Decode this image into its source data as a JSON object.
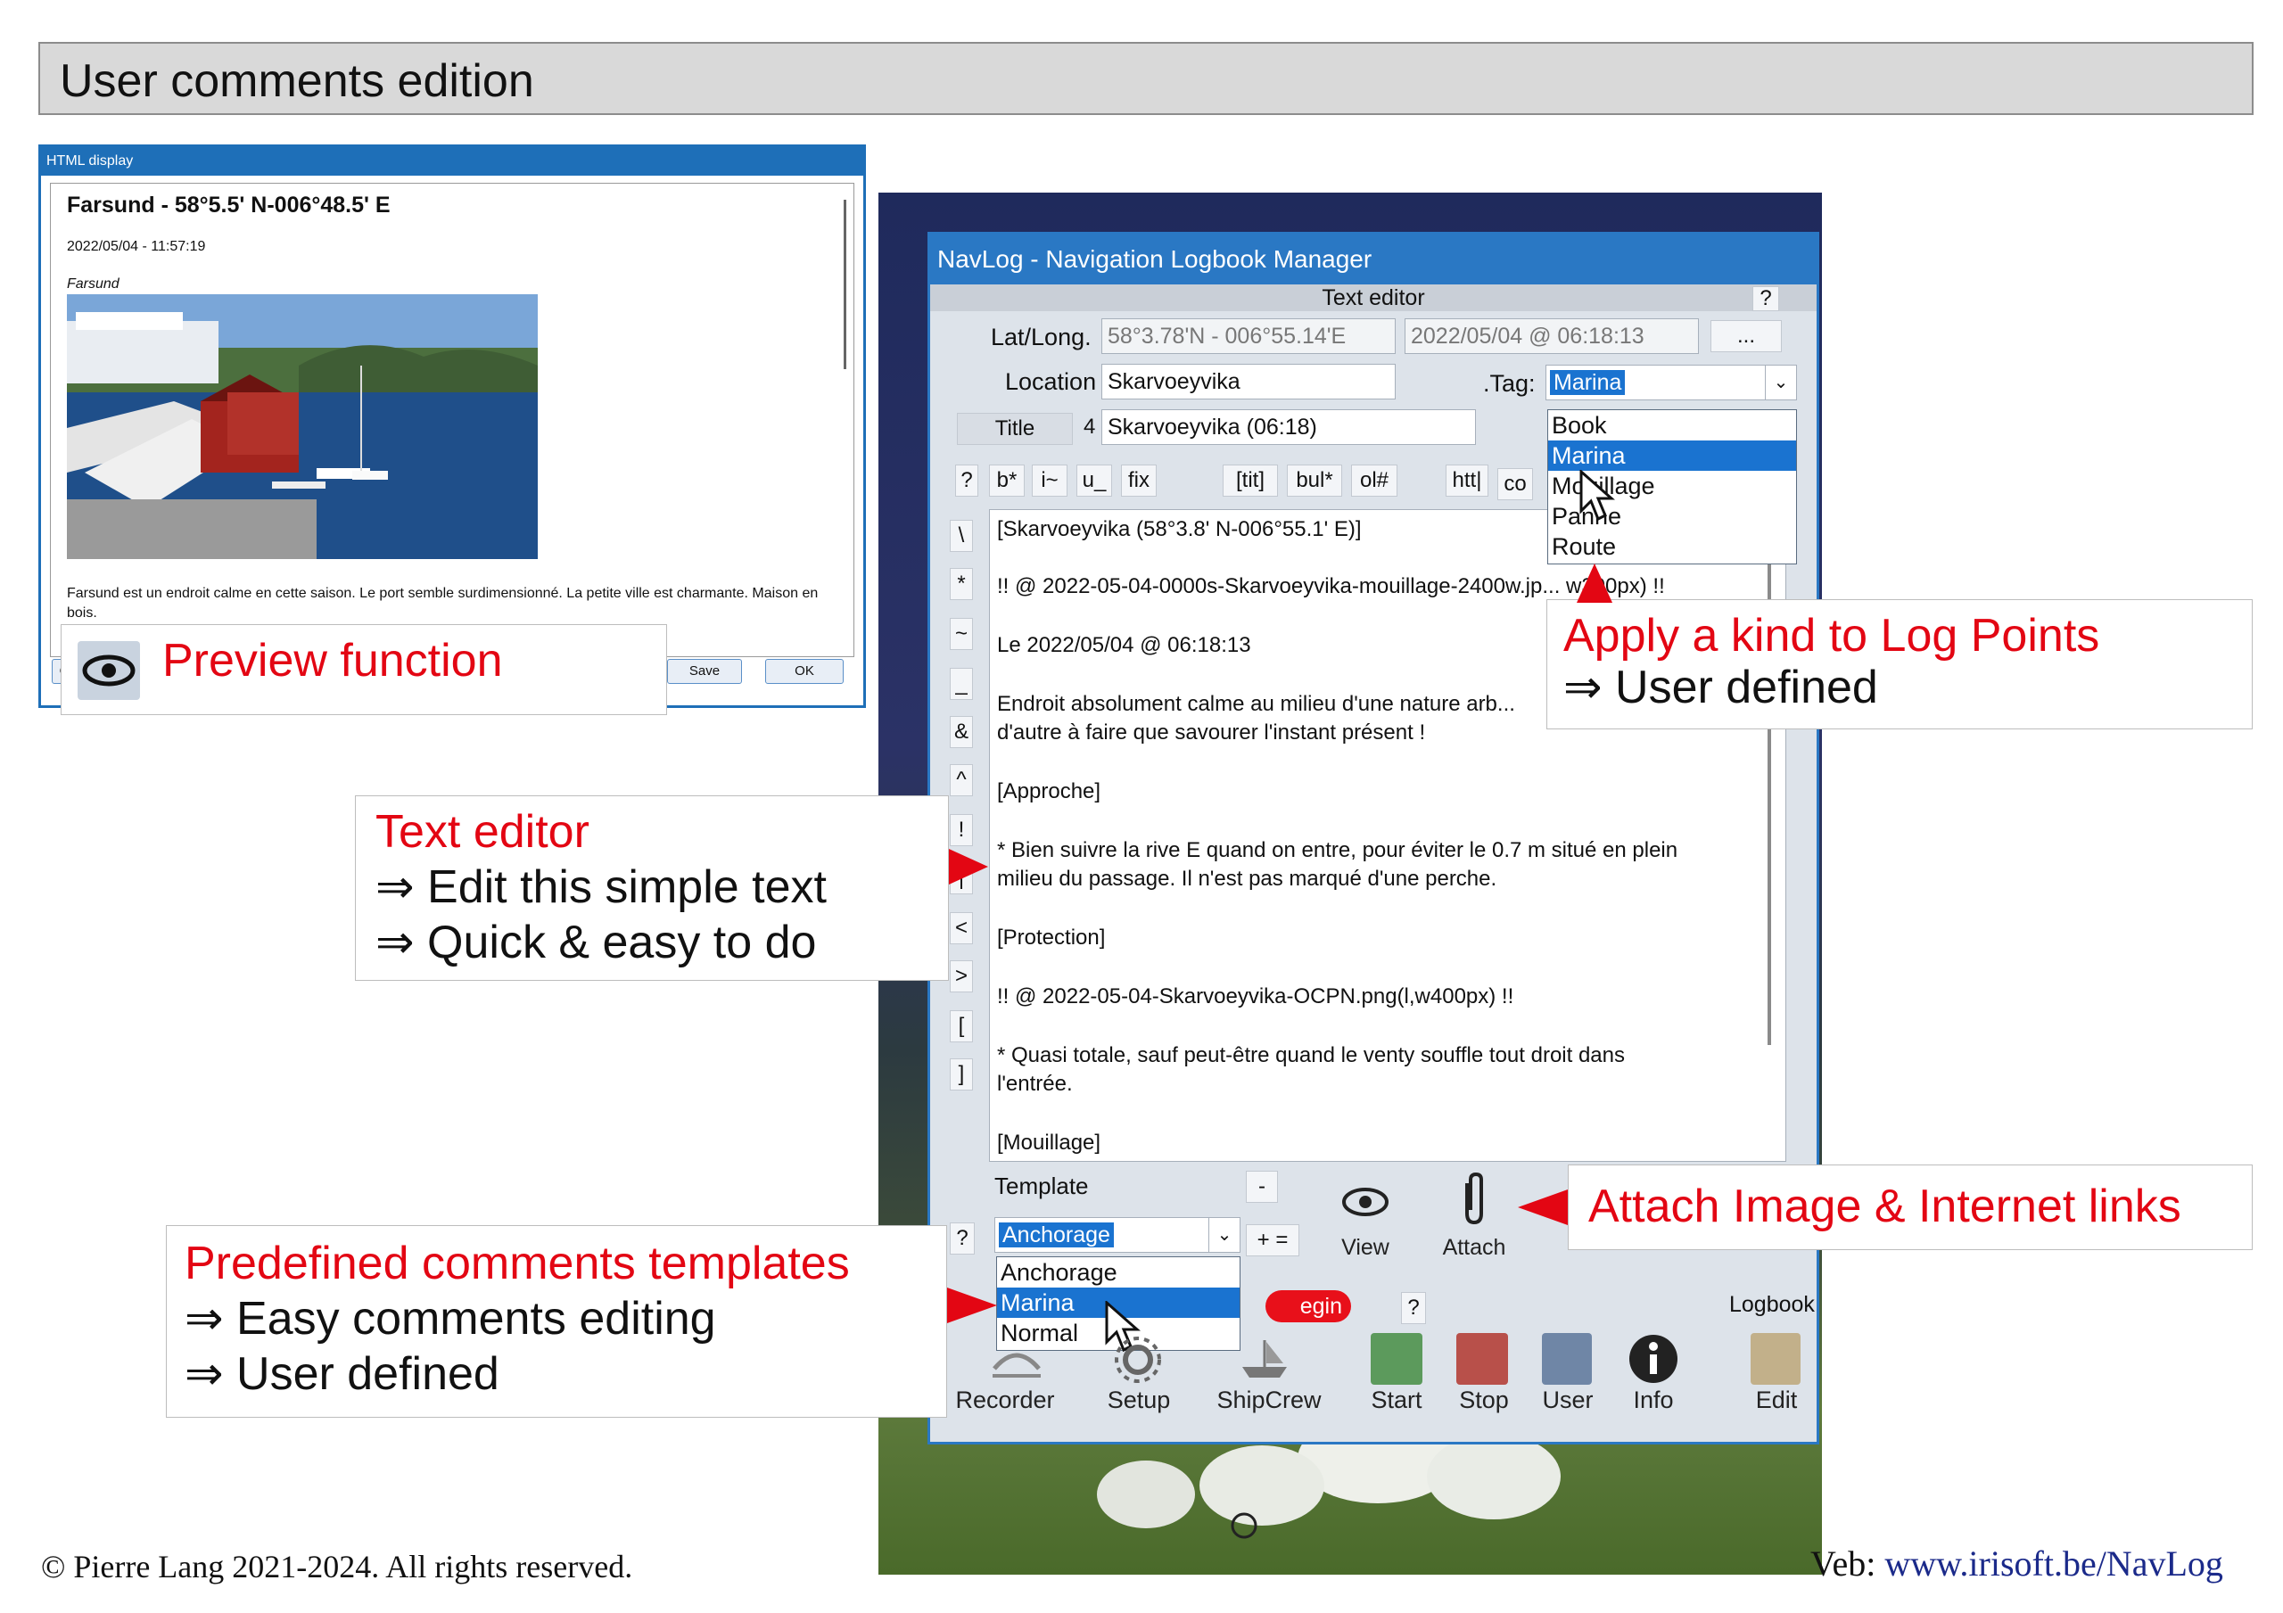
{
  "header": {
    "title": "User comments edition"
  },
  "html_display": {
    "window_title": "HTML display",
    "heading": "Farsund - 58°5.5' N-006°48.5' E",
    "datetime": "2022/05/04 - 11:57:19",
    "place": "Farsund",
    "body_text": "Farsund est un endroit calme en cette saison. Le port semble surdimensionné. La petite ville est charmante. Maison en bois.",
    "save_label": "Save",
    "ok_label": "OK",
    "left_button_fragment": "C"
  },
  "annotations": {
    "preview": "Preview function",
    "apply_kind_title": "Apply a kind to Log Points",
    "apply_kind_sub": "⇒ User defined",
    "text_editor_title": "Text editor",
    "text_editor_l1": "⇒ Edit this simple text",
    "text_editor_l2": "⇒ Quick & easy to do",
    "attach": "Attach Image & Internet links",
    "templates_title": "Predefined comments templates",
    "templates_l1": "⇒ Easy comments editing",
    "templates_l2": "⇒ User defined"
  },
  "navlog": {
    "window_title": "NavLog - Navigation Logbook Manager",
    "section_title": "Text editor",
    "help": "?",
    "latlong_label": "Lat/Long.",
    "latlong_value": "58°3.78'N - 006°55.14'E",
    "date_value": "2022/05/04 @ 06:18:13",
    "more_button": "...",
    "location_label": "Location",
    "location_value": "Skarvoeyvika",
    "tag_label": ".Tag:",
    "tag_value": "Marina",
    "title_button": "Title",
    "title_count": "4",
    "title_value": "Skarvoeyvika (06:18)",
    "format_buttons": [
      "?",
      "b*",
      "i~",
      "u_",
      "fix",
      "[tit]",
      "bul*",
      "ol#",
      "htt|",
      "co"
    ],
    "side_buttons": [
      "\\",
      "*",
      "~",
      "_",
      "&",
      "^",
      "!",
      "|",
      "<",
      ">",
      "[",
      "]"
    ],
    "tag_options": [
      "Book",
      "Marina",
      "Mouillage",
      "Panne",
      "Route"
    ],
    "tag_selected": "Marina",
    "text_lines": [
      "[Skarvoeyvika (58°3.8' N-006°55.1' E)]",
      "!! @ 2022-05-04-0000s-Skarvoeyvika-mouillage-2400w.jp... w300px) !!",
      "Le 2022/05/04 @ 06:18:13",
      "Endroit absolument calme au milieu d'une nature arb...",
      "d'autre à faire que savourer l'instant présent !",
      "[Approche]",
      "* Bien suivre la rive E quand on entre, pour éviter le 0.7 m situé en plein",
      "milieu du passage. Il n'est pas marqué d'une perche.",
      "[Protection]",
      "!! @ 2022-05-04-Skarvoeyvika-OCPN.png(l,w400px) !!",
      "* Quasi totale, sauf peut-être quand le venty souffle tout droit dans",
      "l'entrée.",
      "[Mouillage]"
    ],
    "template_label": "Template",
    "template_value": "Anchorage",
    "template_options": [
      "Anchorage",
      "Marina",
      "Normal"
    ],
    "template_selected": "Marina",
    "minus_button": "-",
    "plus_eq_button": "+ =",
    "view_label": "View",
    "attach_label": "Attach",
    "begin_fragment": "egin",
    "logbook_label": "Logbook",
    "toolbar": [
      "Recorder",
      "Setup",
      "ShipCrew",
      "Start",
      "Stop",
      "User",
      "Info",
      "Edit"
    ]
  },
  "footer": {
    "copyright": "© Pierre Lang 2021-2024. All rights reserved.",
    "web_prefix": "Veb: ",
    "web_link": "www.irisoft.be/NavLog"
  }
}
